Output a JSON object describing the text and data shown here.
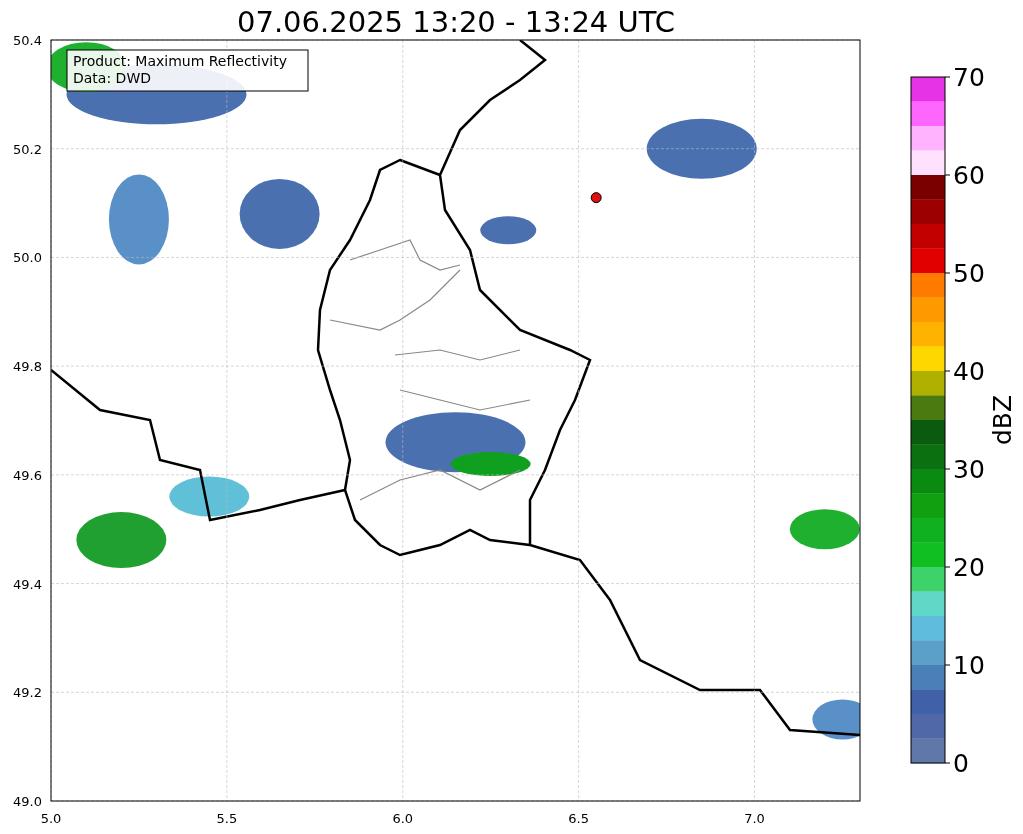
{
  "title": "07.06.2025 13:20 - 13:24 UTC",
  "legend": {
    "lines": [
      "Product: Maximum Reflectivity",
      "Data: DWD"
    ]
  },
  "map": {
    "xticks": [
      "5.0",
      "5.5",
      "6.0",
      "6.5",
      "7.0"
    ],
    "yticks": [
      "50.4",
      "50.2",
      "50.0",
      "49.8",
      "49.6",
      "49.4",
      "49.2",
      "49.0"
    ]
  },
  "colorbar": {
    "label": "dBZ",
    "ticks": [
      "70",
      "60",
      "50",
      "40",
      "30",
      "20",
      "10",
      "0"
    ],
    "segments": [
      {
        "color": "#e633e6"
      },
      {
        "color": "#ff66ff"
      },
      {
        "color": "#ffb3ff"
      },
      {
        "color": "#ffe0ff"
      },
      {
        "color": "#7a0000"
      },
      {
        "color": "#9c0000"
      },
      {
        "color": "#c20000"
      },
      {
        "color": "#e00000"
      },
      {
        "color": "#ff7b00"
      },
      {
        "color": "#ff9900"
      },
      {
        "color": "#ffb300"
      },
      {
        "color": "#ffd700"
      },
      {
        "color": "#b0b000"
      },
      {
        "color": "#4a7a10"
      },
      {
        "color": "#0a5a10"
      },
      {
        "color": "#0a7010"
      },
      {
        "color": "#0a8a10"
      },
      {
        "color": "#10a010"
      },
      {
        "color": "#10b020"
      },
      {
        "color": "#10c020"
      },
      {
        "color": "#3dd36a"
      },
      {
        "color": "#60d8c8"
      },
      {
        "color": "#60bcdc"
      },
      {
        "color": "#5aa0c8"
      },
      {
        "color": "#4a80b8"
      },
      {
        "color": "#4060a8"
      },
      {
        "color": "#5068a8"
      },
      {
        "color": "#6078a8"
      }
    ]
  }
}
